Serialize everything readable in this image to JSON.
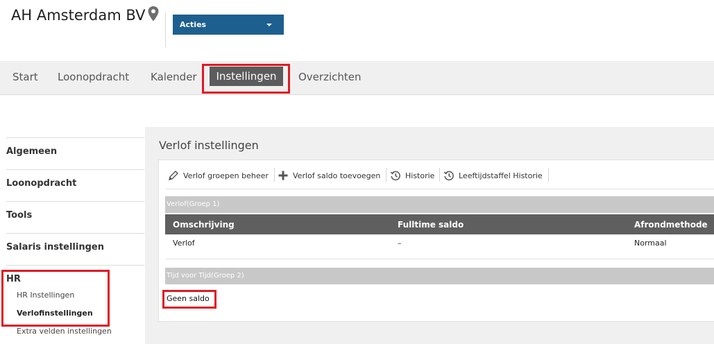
{
  "header": {
    "company": "AH Amsterdam BV",
    "actions_label": "Acties"
  },
  "nav": {
    "start": "Start",
    "loonopdracht": "Loonopdracht",
    "kalender": "Kalender",
    "instellingen": "Instellingen",
    "overzichten": "Overzichten"
  },
  "sidebar": {
    "algemeen": "Algemeen",
    "loonopdracht": "Loonopdracht",
    "tools": "Tools",
    "salaris": "Salaris instellingen",
    "hr": "HR",
    "hr_instellingen": "HR Instellingen",
    "verlofinstellingen": "Verlofinstellingen",
    "extra_velden": "Extra velden instellingen"
  },
  "main": {
    "title": "Verlof instellingen",
    "toolbar": {
      "groepen": "Verlof groepen beheer",
      "saldo": "Verlof saldo toevoegen",
      "historie": "Historie",
      "leeftijd": "Leeftijdstaffel Historie"
    },
    "group1": {
      "title": "Verlof(Groep 1)",
      "columns": [
        "Omschrijving",
        "Fulltime saldo",
        "Afrondmethode"
      ],
      "rows": [
        [
          "Verlof",
          "–",
          "Normaal"
        ]
      ]
    },
    "group2": {
      "title": "Tijd voor Tijd(Groep 2)",
      "empty": "Geen saldo"
    }
  },
  "colors": {
    "actions_bg": "#1d5f8e",
    "nav_active_bg": "#5c5c5c",
    "highlight": "#e01a24",
    "table_header_bg": "#5f5f5f",
    "group_bar_bg": "#c8c8c8"
  }
}
